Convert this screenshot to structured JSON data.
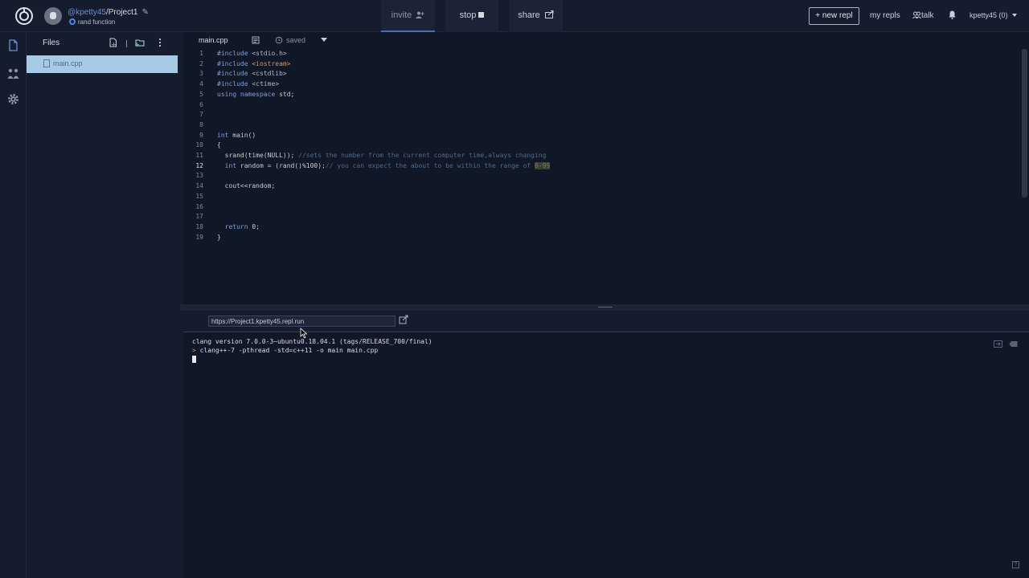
{
  "topbar": {
    "username": "@kpetty45",
    "project_name": "/Project1",
    "subtitle": "rand function",
    "invite_label": "invite",
    "stop_label": "stop",
    "share_label": "share",
    "new_repl_label": "+ new repl",
    "my_repls_label": "my repls",
    "talk_label": "talk",
    "user_menu_label": "kpetty45 (0)"
  },
  "sidebar": {
    "files_title": "Files",
    "files": [
      "main.cpp"
    ]
  },
  "editor": {
    "tab_label": "main.cpp",
    "status_label": "saved",
    "active_line": 12,
    "line_numbers": [
      "1",
      "2",
      "3",
      "4",
      "5",
      "6",
      "7",
      "8",
      "9",
      "10",
      "11",
      "12",
      "13",
      "14",
      "15",
      "16",
      "17",
      "18",
      "19"
    ],
    "lines": {
      "l1_a": "#include ",
      "l1_b": "<stdio.h>",
      "l2_a": "#include ",
      "l2_b": "<iostream>",
      "l3_a": "#include ",
      "l3_b": "<cstdlib>",
      "l4_a": "#include ",
      "l4_b": "<ctime>",
      "l5_a": "using ",
      "l5_b": "namespace ",
      "l5_c": "std;",
      "l9_a": "int ",
      "l9_b": "main()",
      "l10": "{",
      "l11_a": "  srand(time(NULL)); ",
      "l11_b": "//sets the number from the current computer time,always changing",
      "l12_a": "  int ",
      "l12_b": "random = (rand()%100);",
      "l12_c": "// you can expect the about to be within the range of ",
      "l12_d": "0-99",
      "l14": "  cout<<random;",
      "l18_a": "  return ",
      "l18_b": "0;",
      "l19": "}"
    }
  },
  "webview": {
    "url": "https://Project1.kpetty45.repl.run"
  },
  "terminal": {
    "line1": "clang version 7.0.0-3~ubuntu0.18.04.1 (tags/RELEASE_700/final)",
    "prompt_symbol": ">",
    "line2": " clang++-7 -pthread -std=c++11 -o main main.cpp"
  },
  "help_label": "?",
  "colors": {
    "background": "#101727",
    "panel": "#141c2d",
    "selected_file": "#a7cbe7",
    "accent_blue": "#4f86e8",
    "prompt_orange": "#e07b4d"
  }
}
